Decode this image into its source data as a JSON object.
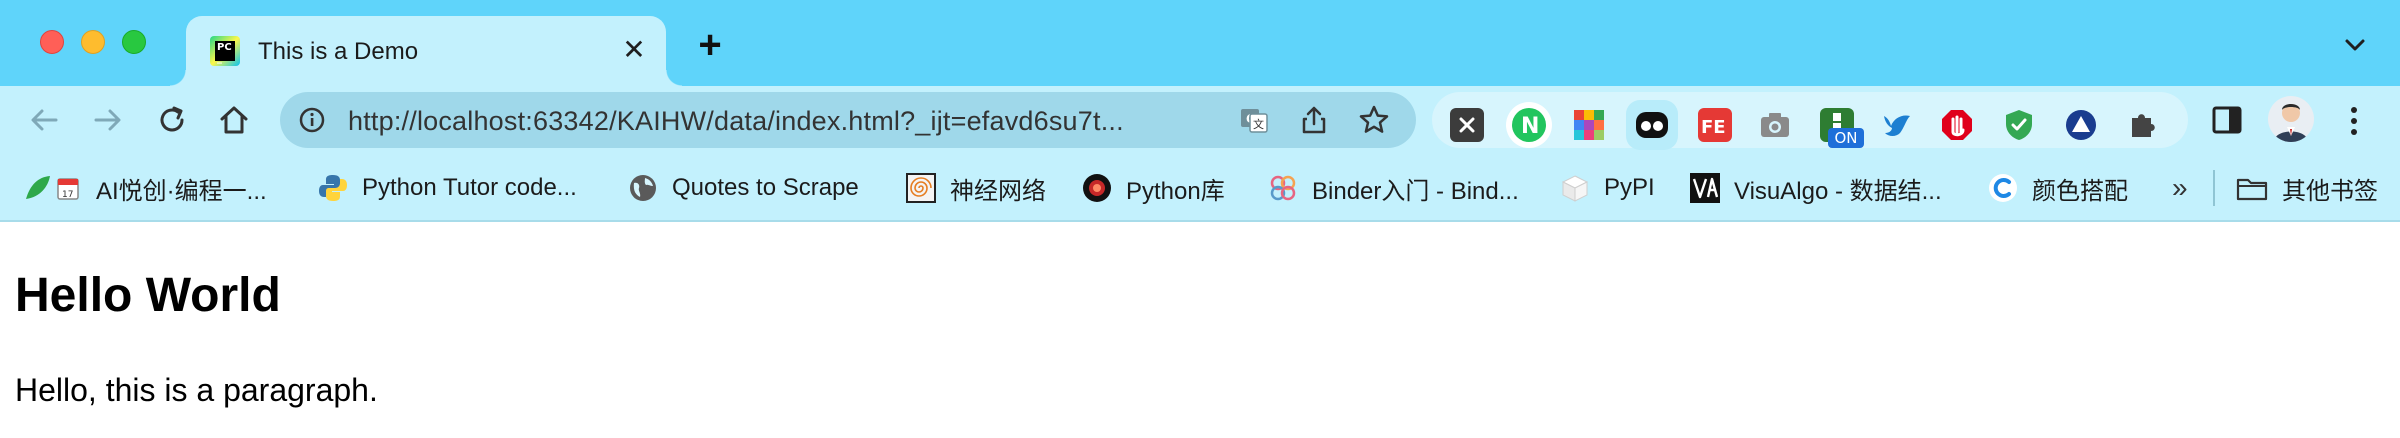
{
  "window": {
    "tab": {
      "title": "This is a Demo",
      "close_glyph": "✕",
      "favicon": "pycharm-icon"
    },
    "new_tab_glyph": "+"
  },
  "toolbar": {
    "url": "http://localhost:63342/KAIHW/data/index.html?_ijt=efavd6su7t...",
    "extensions": [
      {
        "name": "x-extension",
        "color": "#3c3c3c"
      },
      {
        "name": "nuxt-extension",
        "color": "#00dc82"
      },
      {
        "name": "colorful-grid-extension",
        "color": "#ea4335"
      },
      {
        "name": "ghost-extension",
        "color": "#111111"
      },
      {
        "name": "fe-extension",
        "color": "#e53935"
      },
      {
        "name": "camera-extension",
        "color": "#8a8a8a"
      },
      {
        "name": "on-extension",
        "color": "#2e7d32",
        "badge": "ON"
      },
      {
        "name": "bird-extension",
        "color": "#1d7fd1"
      },
      {
        "name": "adblock-extension",
        "color": "#e0001b"
      },
      {
        "name": "shield-extension",
        "color": "#34a853"
      },
      {
        "name": "triangle-extension",
        "color": "#1a3c8f"
      },
      {
        "name": "puzzle-extension",
        "color": "#444444"
      }
    ]
  },
  "bookmarks": {
    "items": [
      {
        "label": "AI悦创·编程一...",
        "icon": "leaf-calendar-icon"
      },
      {
        "label": "Python Tutor code...",
        "icon": "python-icon"
      },
      {
        "label": "Quotes to Scrape",
        "icon": "globe-icon"
      },
      {
        "label": "神经网络",
        "icon": "spiral-icon"
      },
      {
        "label": "Python库",
        "icon": "red-glow-icon"
      },
      {
        "label": "Binder入门 - Bind...",
        "icon": "binder-icon"
      },
      {
        "label": "PyPI",
        "icon": "cube-icon"
      },
      {
        "label": "VisuAlgo - 数据结...",
        "icon": "visualgo-icon"
      },
      {
        "label": "颜色搭配",
        "icon": "c-icon"
      }
    ],
    "more_glyph": "»",
    "other_folder": "其他书签"
  },
  "page": {
    "heading": "Hello World",
    "paragraph": "Hello, this is a paragraph."
  },
  "colors": {
    "frame": "#5fd4fa",
    "toolbar": "#c3f1fd",
    "omnibox": "#9fd8ea"
  }
}
